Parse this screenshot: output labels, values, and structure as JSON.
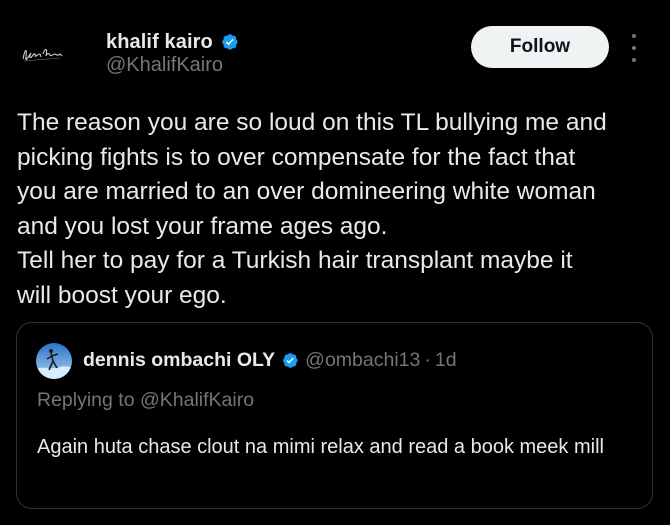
{
  "post": {
    "author": {
      "name": "khalif kairo",
      "handle": "@KhalifKairo",
      "avatar_signature": "Khalif Kairo",
      "verified": true
    },
    "follow_label": "Follow",
    "more_icon": "more-vertical-icon",
    "text": "The reason you are so loud on this TL bullying me and\npicking fights is to over compensate for the fact that\nyou are married to an over domineering white woman\nand you lost your frame ages ago.\nTell her to pay for a Turkish hair transplant maybe it\nwill boost your ego."
  },
  "quote": {
    "author": {
      "name": "dennis ombachi OLY",
      "handle": "@ombachi13",
      "verified": true
    },
    "separator": "·",
    "time": "1d",
    "replying_to": "Replying to @KhalifKairo",
    "text": "Again huta chase clout na mimi relax and read a book meek mill"
  },
  "colors": {
    "background": "#000000",
    "text_primary": "#e7e9ea",
    "text_secondary": "#71767b",
    "verified_blue": "#1d9bf0",
    "follow_button_bg": "#eff3f4",
    "border": "#2f3336"
  }
}
